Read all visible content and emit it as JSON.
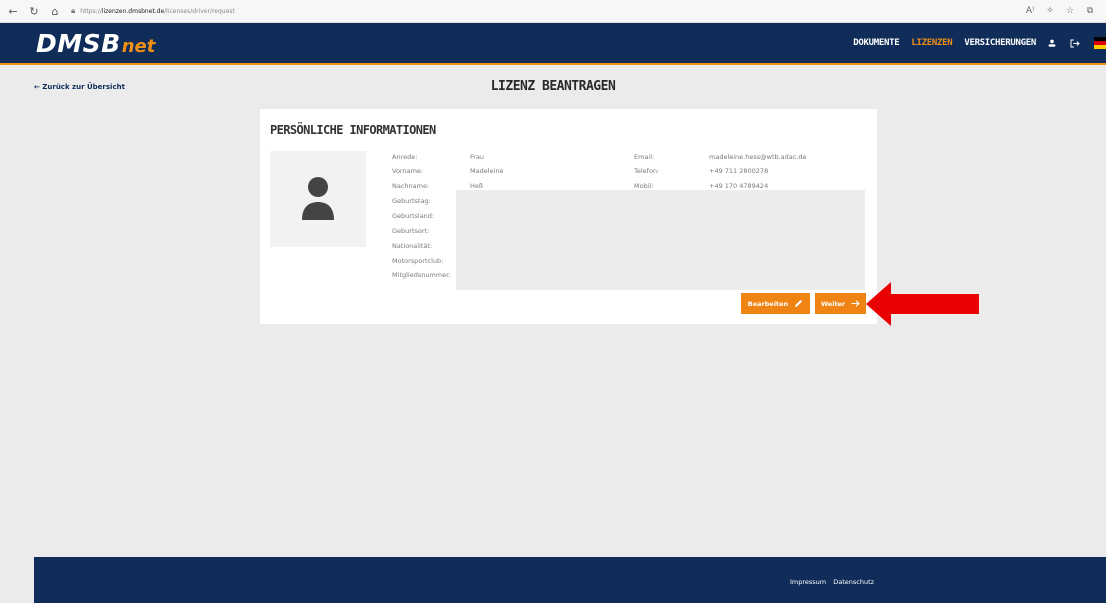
{
  "browser": {
    "url_protocol": "https://",
    "url_host": "lizenzen.dmsbnet.de",
    "url_path": "/licenses/driver/request"
  },
  "header": {
    "logo_main": "DMSB",
    "logo_sub": "net",
    "nav": [
      "DOKUMENTE",
      "LIZENZEN",
      "VERSICHERUNGEN"
    ],
    "active_nav": "LIZENZEN",
    "accent_color": "#f09013",
    "primary_color": "#102d5a"
  },
  "page": {
    "back_label": "← Zurück zur Übersicht",
    "title": "LIZENZ BEANTRAGEN"
  },
  "card": {
    "title": "PERSÖNLICHE INFORMATIONEN",
    "left_fields": [
      {
        "label": "Anrede:",
        "value": "Frau"
      },
      {
        "label": "Vorname:",
        "value": "Madeleine"
      },
      {
        "label": "Nachname:",
        "value": "Heß"
      },
      {
        "label": "Geburtstag:",
        "value": ""
      },
      {
        "label": "Geburtsland:",
        "value": ""
      },
      {
        "label": "Geburtsort:",
        "value": ""
      },
      {
        "label": "Nationalität:",
        "value": ""
      },
      {
        "label": "Motorsportclub:",
        "value": ""
      },
      {
        "label": "Mitgliedsnummer:",
        "value": ""
      }
    ],
    "right_fields": [
      {
        "label": "Email:",
        "value": "madeleine.hess@wtb.adac.de"
      },
      {
        "label": "Telefon:",
        "value": "+49 711 2800278"
      },
      {
        "label": "Mobil:",
        "value": "+49 170 4789424"
      }
    ],
    "edit_button": "Bearbeiten",
    "next_button": "Weiter"
  },
  "footer": {
    "links": [
      "Impressum",
      "Datenschutz"
    ]
  }
}
